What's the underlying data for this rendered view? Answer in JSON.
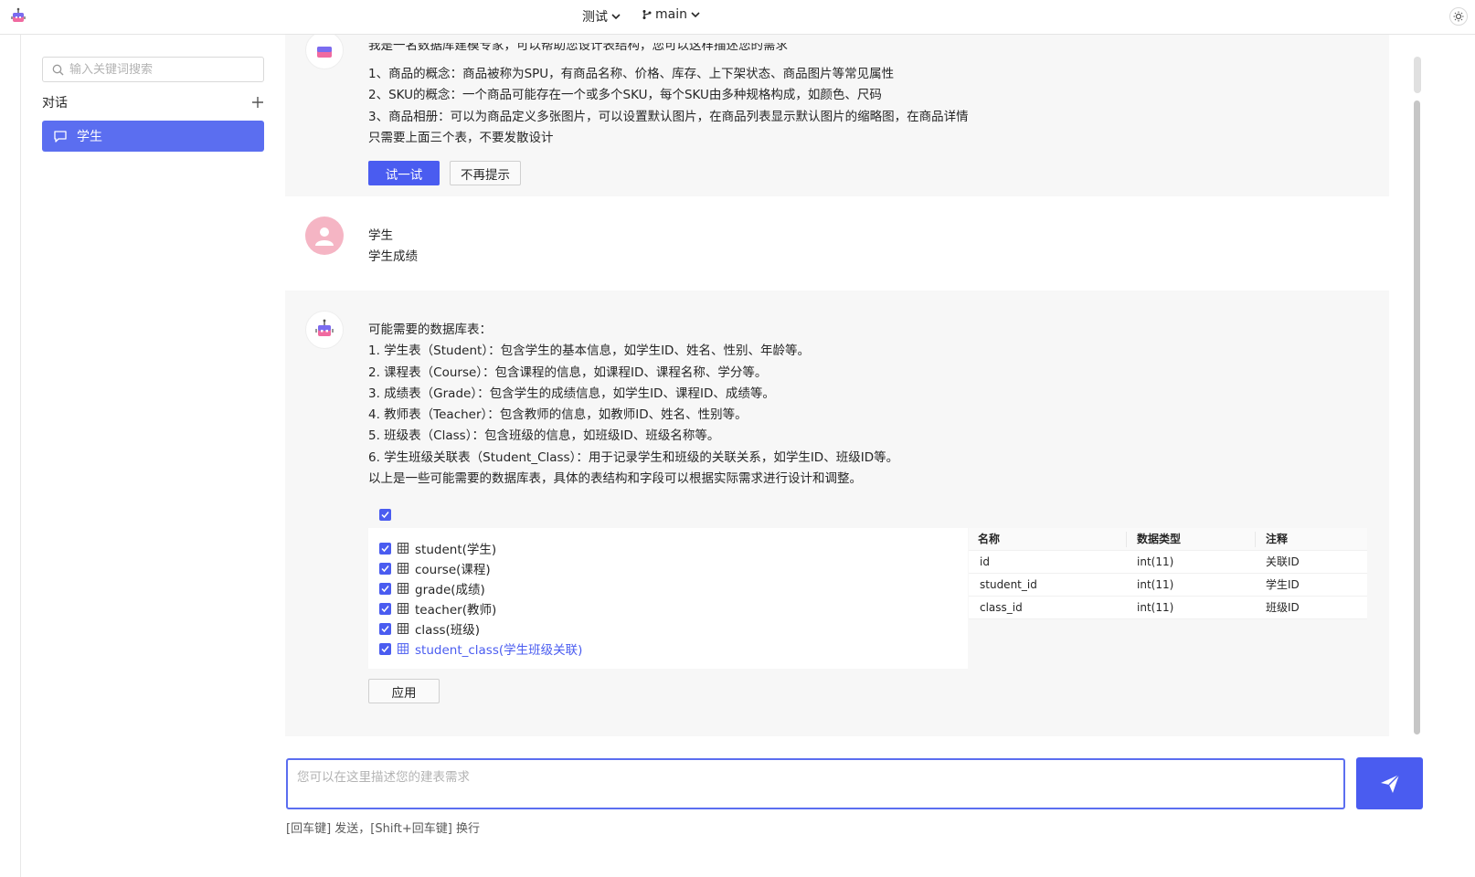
{
  "header": {
    "project_label": "测试",
    "branch_label": "main"
  },
  "sidebar": {
    "search_placeholder": "输入关键词搜索",
    "section_title": "对话",
    "conversations": [
      {
        "label": "学生"
      }
    ]
  },
  "bot_intro": {
    "partial_line": "我是一名数据库建模专家，可以帮助您设计表结构，您可以这样描述您的需求",
    "lines": [
      "1、商品的概念：商品被称为SPU，有商品名称、价格、库存、上下架状态、商品图片等常见属性",
      "2、SKU的概念：一个商品可能存在一个或多个SKU，每个SKU由多种规格构成，如颜色、尺码",
      "3、商品相册：可以为商品定义多张图片，可以设置默认图片，在商品列表显示默认图片的缩略图，在商品详情",
      "只需要上面三个表，不要发散设计"
    ],
    "try_button": "试一试",
    "dismiss_button": "不再提示"
  },
  "user_message": {
    "lines": [
      "学生",
      "学生成绩"
    ]
  },
  "bot_reply": {
    "lines": [
      "可能需要的数据库表：",
      "1. 学生表（Student）：包含学生的基本信息，如学生ID、姓名、性别、年龄等。",
      "2. 课程表（Course）：包含课程的信息，如课程ID、课程名称、学分等。",
      "3. 成绩表（Grade）：包含学生的成绩信息，如学生ID、课程ID、成绩等。",
      "4. 教师表（Teacher）：包含教师的信息，如教师ID、姓名、性别等。",
      "5. 班级表（Class）：包含班级的信息，如班级ID、班级名称等。",
      "6. 学生班级关联表（Student_Class）：用于记录学生和班级的关联关系，如学生ID、班级ID等。",
      "以上是一些可能需要的数据库表，具体的表结构和字段可以根据实际需求进行设计和调整。"
    ],
    "tables": [
      {
        "label": "student(学生)",
        "checked": true
      },
      {
        "label": "course(课程)",
        "checked": true
      },
      {
        "label": "grade(成绩)",
        "checked": true
      },
      {
        "label": "teacher(教师)",
        "checked": true
      },
      {
        "label": "class(班级)",
        "checked": true
      },
      {
        "label": "student_class(学生班级关联)",
        "checked": true,
        "active": true
      }
    ],
    "apply_button": "应用",
    "fields_table": {
      "headers": [
        "名称",
        "数据类型",
        "注释"
      ],
      "rows": [
        [
          "id",
          "int(11)",
          "关联ID"
        ],
        [
          "student_id",
          "int(11)",
          "学生ID"
        ],
        [
          "class_id",
          "int(11)",
          "班级ID"
        ]
      ]
    }
  },
  "composer": {
    "placeholder": "您可以在这里描述您的建表需求",
    "hint": "[回车键] 发送，[Shift+回车键] 换行"
  },
  "colors": {
    "accent": "#4a5cf0",
    "sidebar_active": "#5b6ef0",
    "message_bg": "#f7f7f7"
  }
}
